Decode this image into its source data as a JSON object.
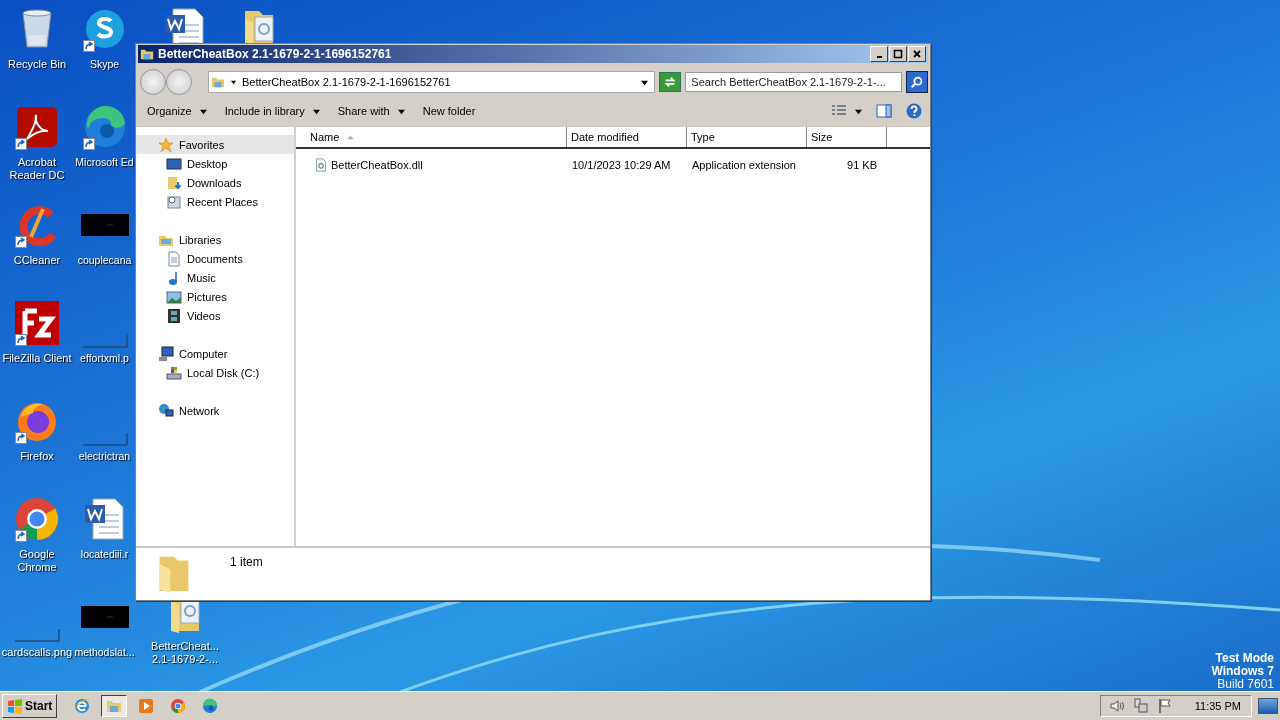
{
  "desktop": {
    "columns": [
      [
        {
          "kind": "recycle",
          "label": "Recycle Bin"
        },
        {
          "kind": "acrobat",
          "label": "Acrobat Reader DC",
          "shortcut": true
        },
        {
          "kind": "ccleaner",
          "label": "CCleaner",
          "shortcut": true
        },
        {
          "kind": "filezilla",
          "label": "FileZilla Client",
          "shortcut": true
        },
        {
          "kind": "firefox",
          "label": "Firefox",
          "shortcut": true
        },
        {
          "kind": "chrome",
          "label": "Google Chrome",
          "shortcut": true
        },
        {
          "kind": "thin",
          "label": "cardscalls.png"
        }
      ],
      [
        {
          "kind": "skype",
          "label": "Skype",
          "shortcut": true
        },
        {
          "kind": "edge",
          "label": "Microsoft Ed",
          "shortcut": true
        },
        {
          "kind": "black",
          "label": "couplecana"
        },
        {
          "kind": "thin",
          "label": "effortxml.p"
        },
        {
          "kind": "thin",
          "label": "electrictran"
        },
        {
          "kind": "word",
          "label": "locatediii.r"
        },
        {
          "kind": "black",
          "label": "methodslat..."
        }
      ],
      [
        {
          "kind": "word"
        },
        {
          "kind": "folderdoc",
          "label": "BetterCheat... 2.1-1679-2-..."
        }
      ],
      [
        {
          "kind": "folderdoc"
        }
      ]
    ],
    "notice": [
      "Test Mode",
      "Windows 7",
      "Build 7601"
    ]
  },
  "window": {
    "title": "BetterCheatBox 2.1-1679-2-1-1696152761",
    "address": "BetterCheatBox 2.1-1679-2-1-1696152761",
    "search": {
      "placeholder": "Search BetterCheatBox 2.1-1679-2-1-..."
    },
    "toolbar": [
      {
        "label": "Organize",
        "dropdown": true
      },
      {
        "label": "Include in library",
        "dropdown": true
      },
      {
        "label": "Share with",
        "dropdown": true
      },
      {
        "label": "New folder",
        "dropdown": false
      }
    ],
    "nav": [
      {
        "label": "Favorites",
        "kind": "star",
        "selected": true,
        "children": [
          {
            "label": "Desktop",
            "kind": "desktop",
            "selected": false
          },
          {
            "label": "Downloads",
            "kind": "downloads",
            "selected": false
          },
          {
            "label": "Recent Places",
            "kind": "recent",
            "selected": false
          }
        ]
      },
      {
        "label": "Libraries",
        "kind": "library",
        "selected": false,
        "children": [
          {
            "label": "Documents",
            "kind": "documents",
            "selected": false
          },
          {
            "label": "Music",
            "kind": "music",
            "selected": false
          },
          {
            "label": "Pictures",
            "kind": "pictures",
            "selected": false
          },
          {
            "label": "Videos",
            "kind": "videos",
            "selected": false
          }
        ]
      },
      {
        "label": "Computer",
        "kind": "computer",
        "selected": false,
        "children": [
          {
            "label": "Local Disk (C:)",
            "kind": "disk",
            "selected": false
          }
        ]
      },
      {
        "label": "Network",
        "kind": "network",
        "selected": false
      }
    ],
    "columns": [
      {
        "label": "Name",
        "sorted": true
      },
      {
        "label": "Date modified",
        "sorted": false
      },
      {
        "label": "Type",
        "sorted": false
      },
      {
        "label": "Size",
        "sorted": false
      }
    ],
    "files": [
      {
        "name": "BetterCheatBox.dll",
        "date": "10/1/2023 10:29 AM",
        "type": "Application extension",
        "size": "91 KB"
      }
    ],
    "status": "1 item"
  },
  "taskbar": {
    "start": "Start",
    "apps": [
      {
        "kind": "ie",
        "active": false
      },
      {
        "kind": "explorer",
        "active": true
      },
      {
        "kind": "media",
        "active": false
      },
      {
        "kind": "chrome",
        "active": false
      },
      {
        "kind": "edge",
        "active": false
      }
    ],
    "clock": "11:35 PM"
  }
}
